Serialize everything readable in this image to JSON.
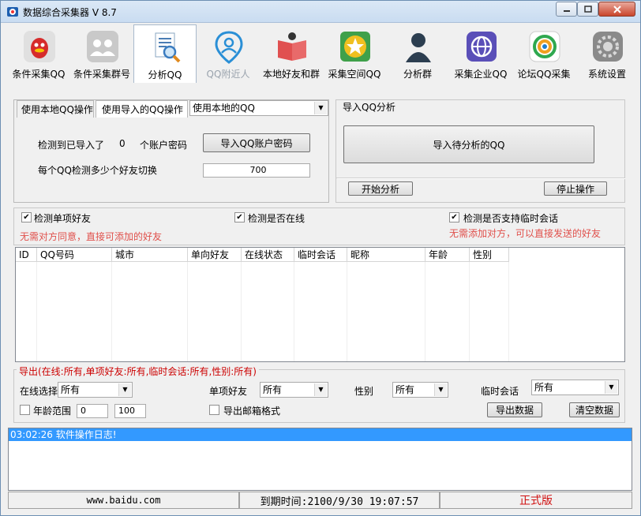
{
  "window": {
    "title": "数据综合采集器 V 8.7"
  },
  "toolbar": {
    "items": [
      {
        "label": "条件采集QQ",
        "icon": "qq-penguin-icon"
      },
      {
        "label": "条件采集群号",
        "icon": "group-people-icon"
      },
      {
        "label": "分析QQ",
        "icon": "magnifier-document-icon",
        "active": true
      },
      {
        "label": "QQ附近人",
        "icon": "location-pin-person-icon",
        "disabled": true
      },
      {
        "label": "本地好友和群",
        "icon": "book-person-icon"
      },
      {
        "label": "采集空间QQ",
        "icon": "star-space-icon"
      },
      {
        "label": "分析群",
        "icon": "person-silhouette-icon"
      },
      {
        "label": "采集企业QQ",
        "icon": "globe-icon"
      },
      {
        "label": "论坛QQ采集",
        "icon": "forum-qq-icon"
      },
      {
        "label": "系统设置",
        "icon": "settings-icon"
      }
    ]
  },
  "source": {
    "tab_local": "使用本地QQ操作",
    "tab_import": "使用导入的QQ操作",
    "select_value": "使用本地的QQ",
    "detected_label": "检测到已导入了",
    "detected_count": "0",
    "account_suffix": "个账户密码",
    "import_button": "导入QQ账户密码",
    "per_qq_label": "每个QQ检测多少个好友切换",
    "per_qq_value": "700"
  },
  "import_panel": {
    "group_title": "导入QQ分析",
    "import_button": "导入待分析的QQ",
    "start_button": "开始分析",
    "stop_button": "停止操作"
  },
  "checks": {
    "one_way": {
      "label": "检测单项好友",
      "checked": true,
      "hint": "无需对方同意，直接可添加的好友"
    },
    "online": {
      "label": "检测是否在线",
      "checked": true
    },
    "temp_chat": {
      "label": "检测是否支持临时会话",
      "checked": true,
      "hint": "无需添加对方，可以直接发送的好友"
    }
  },
  "table": {
    "columns": [
      "ID",
      "QQ号码",
      "城市",
      "单向好友",
      "在线状态",
      "临时会话",
      "昵称",
      "年龄",
      "性别"
    ]
  },
  "export": {
    "title": "导出(在线:所有,单项好友:所有,临时会话:所有,性别:所有)",
    "online_label": "在线选择",
    "online_value": "所有",
    "oneway_label": "单项好友",
    "oneway_value": "所有",
    "gender_label": "性别",
    "gender_value": "所有",
    "temp_label": "临时会话",
    "temp_value": "所有",
    "age_label": "年龄范围",
    "age_min": "0",
    "age_max": "100",
    "email_label": "导出邮箱格式",
    "export_button": "导出数据",
    "clear_button": "清空数据"
  },
  "log": {
    "line": "03:02:26 软件操作日志!"
  },
  "statusbar": {
    "site": "www.baidu.com",
    "expiry": "到期时间:2100/9/30 19:07:57",
    "edition": "正式版"
  },
  "colors": {
    "hint_red": "#e0504b",
    "export_title_red": "#cc0000",
    "selection_blue": "#3399ff"
  }
}
